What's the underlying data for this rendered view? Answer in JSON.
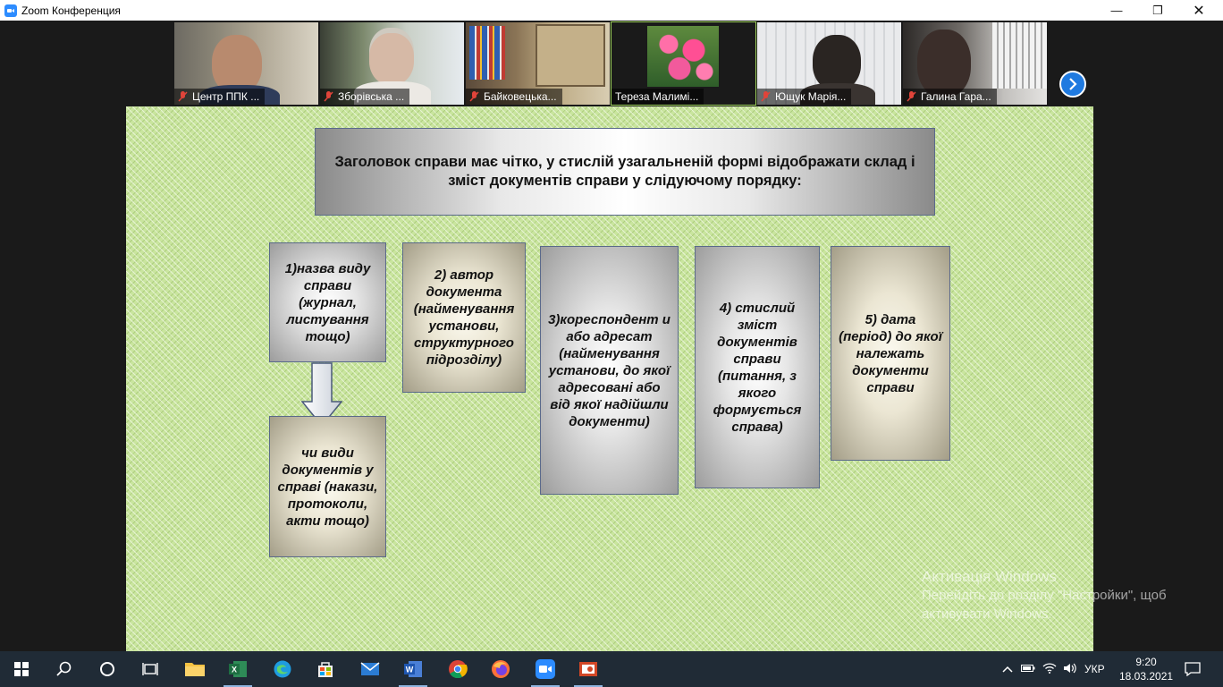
{
  "window": {
    "title": "Zoom Конференция",
    "controls": {
      "minimize": "—",
      "maximize": "❐",
      "close": "✕"
    }
  },
  "participants": [
    {
      "name": "Центр ППК ...",
      "muted": true
    },
    {
      "name": "Зборівська ...",
      "muted": true
    },
    {
      "name": "Байковецька...",
      "muted": true
    },
    {
      "name": "Тереза Малимі...",
      "muted": false,
      "active": true
    },
    {
      "name": "Ющук Марія...",
      "muted": true
    },
    {
      "name": "Галина Гара...",
      "muted": true
    }
  ],
  "slide": {
    "heading": "Заголовок справи має чітко, у стислій узагальненій формі відображати склад і зміст документів справи у слідуючому порядку:",
    "boxes": {
      "b1": "1)назва виду справи (журнал, листування тощо)",
      "b1sub": "чи види документів у справі (накази, протоколи, акти тощо)",
      "b2": "2) автор документа (найменування установи, структурного підрозділу)",
      "b3": "3)кореспондент и або адресат (найменування установи, до якої адресовані або від якої надійшли документи)",
      "b4": "4) стислий зміст документів справи (питання, з якого формується справа)",
      "b5": "5) дата (період) до якої належать документи справи"
    }
  },
  "watermark": {
    "line1": "Активація Windows",
    "line2": "Перейдіть до розділу \"Настройки\", щоб",
    "line3": "активувати Windows."
  },
  "taskbar": {
    "language": "УКР",
    "time": "9:20",
    "date": "18.03.2021"
  }
}
